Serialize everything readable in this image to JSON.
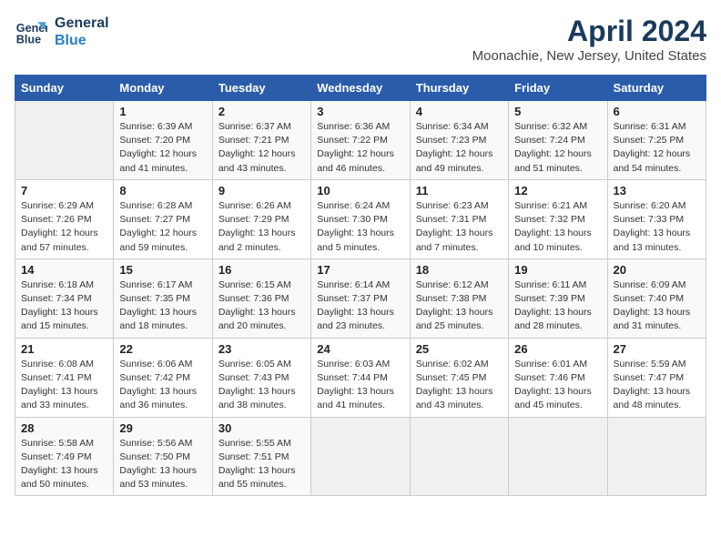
{
  "header": {
    "logo_line1": "General",
    "logo_line2": "Blue",
    "title": "April 2024",
    "subtitle": "Moonachie, New Jersey, United States"
  },
  "calendar": {
    "days_of_week": [
      "Sunday",
      "Monday",
      "Tuesday",
      "Wednesday",
      "Thursday",
      "Friday",
      "Saturday"
    ],
    "weeks": [
      [
        {
          "day": "",
          "info": ""
        },
        {
          "day": "1",
          "info": "Sunrise: 6:39 AM\nSunset: 7:20 PM\nDaylight: 12 hours\nand 41 minutes."
        },
        {
          "day": "2",
          "info": "Sunrise: 6:37 AM\nSunset: 7:21 PM\nDaylight: 12 hours\nand 43 minutes."
        },
        {
          "day": "3",
          "info": "Sunrise: 6:36 AM\nSunset: 7:22 PM\nDaylight: 12 hours\nand 46 minutes."
        },
        {
          "day": "4",
          "info": "Sunrise: 6:34 AM\nSunset: 7:23 PM\nDaylight: 12 hours\nand 49 minutes."
        },
        {
          "day": "5",
          "info": "Sunrise: 6:32 AM\nSunset: 7:24 PM\nDaylight: 12 hours\nand 51 minutes."
        },
        {
          "day": "6",
          "info": "Sunrise: 6:31 AM\nSunset: 7:25 PM\nDaylight: 12 hours\nand 54 minutes."
        }
      ],
      [
        {
          "day": "7",
          "info": "Sunrise: 6:29 AM\nSunset: 7:26 PM\nDaylight: 12 hours\nand 57 minutes."
        },
        {
          "day": "8",
          "info": "Sunrise: 6:28 AM\nSunset: 7:27 PM\nDaylight: 12 hours\nand 59 minutes."
        },
        {
          "day": "9",
          "info": "Sunrise: 6:26 AM\nSunset: 7:29 PM\nDaylight: 13 hours\nand 2 minutes."
        },
        {
          "day": "10",
          "info": "Sunrise: 6:24 AM\nSunset: 7:30 PM\nDaylight: 13 hours\nand 5 minutes."
        },
        {
          "day": "11",
          "info": "Sunrise: 6:23 AM\nSunset: 7:31 PM\nDaylight: 13 hours\nand 7 minutes."
        },
        {
          "day": "12",
          "info": "Sunrise: 6:21 AM\nSunset: 7:32 PM\nDaylight: 13 hours\nand 10 minutes."
        },
        {
          "day": "13",
          "info": "Sunrise: 6:20 AM\nSunset: 7:33 PM\nDaylight: 13 hours\nand 13 minutes."
        }
      ],
      [
        {
          "day": "14",
          "info": "Sunrise: 6:18 AM\nSunset: 7:34 PM\nDaylight: 13 hours\nand 15 minutes."
        },
        {
          "day": "15",
          "info": "Sunrise: 6:17 AM\nSunset: 7:35 PM\nDaylight: 13 hours\nand 18 minutes."
        },
        {
          "day": "16",
          "info": "Sunrise: 6:15 AM\nSunset: 7:36 PM\nDaylight: 13 hours\nand 20 minutes."
        },
        {
          "day": "17",
          "info": "Sunrise: 6:14 AM\nSunset: 7:37 PM\nDaylight: 13 hours\nand 23 minutes."
        },
        {
          "day": "18",
          "info": "Sunrise: 6:12 AM\nSunset: 7:38 PM\nDaylight: 13 hours\nand 25 minutes."
        },
        {
          "day": "19",
          "info": "Sunrise: 6:11 AM\nSunset: 7:39 PM\nDaylight: 13 hours\nand 28 minutes."
        },
        {
          "day": "20",
          "info": "Sunrise: 6:09 AM\nSunset: 7:40 PM\nDaylight: 13 hours\nand 31 minutes."
        }
      ],
      [
        {
          "day": "21",
          "info": "Sunrise: 6:08 AM\nSunset: 7:41 PM\nDaylight: 13 hours\nand 33 minutes."
        },
        {
          "day": "22",
          "info": "Sunrise: 6:06 AM\nSunset: 7:42 PM\nDaylight: 13 hours\nand 36 minutes."
        },
        {
          "day": "23",
          "info": "Sunrise: 6:05 AM\nSunset: 7:43 PM\nDaylight: 13 hours\nand 38 minutes."
        },
        {
          "day": "24",
          "info": "Sunrise: 6:03 AM\nSunset: 7:44 PM\nDaylight: 13 hours\nand 41 minutes."
        },
        {
          "day": "25",
          "info": "Sunrise: 6:02 AM\nSunset: 7:45 PM\nDaylight: 13 hours\nand 43 minutes."
        },
        {
          "day": "26",
          "info": "Sunrise: 6:01 AM\nSunset: 7:46 PM\nDaylight: 13 hours\nand 45 minutes."
        },
        {
          "day": "27",
          "info": "Sunrise: 5:59 AM\nSunset: 7:47 PM\nDaylight: 13 hours\nand 48 minutes."
        }
      ],
      [
        {
          "day": "28",
          "info": "Sunrise: 5:58 AM\nSunset: 7:49 PM\nDaylight: 13 hours\nand 50 minutes."
        },
        {
          "day": "29",
          "info": "Sunrise: 5:56 AM\nSunset: 7:50 PM\nDaylight: 13 hours\nand 53 minutes."
        },
        {
          "day": "30",
          "info": "Sunrise: 5:55 AM\nSunset: 7:51 PM\nDaylight: 13 hours\nand 55 minutes."
        },
        {
          "day": "",
          "info": ""
        },
        {
          "day": "",
          "info": ""
        },
        {
          "day": "",
          "info": ""
        },
        {
          "day": "",
          "info": ""
        }
      ]
    ]
  }
}
